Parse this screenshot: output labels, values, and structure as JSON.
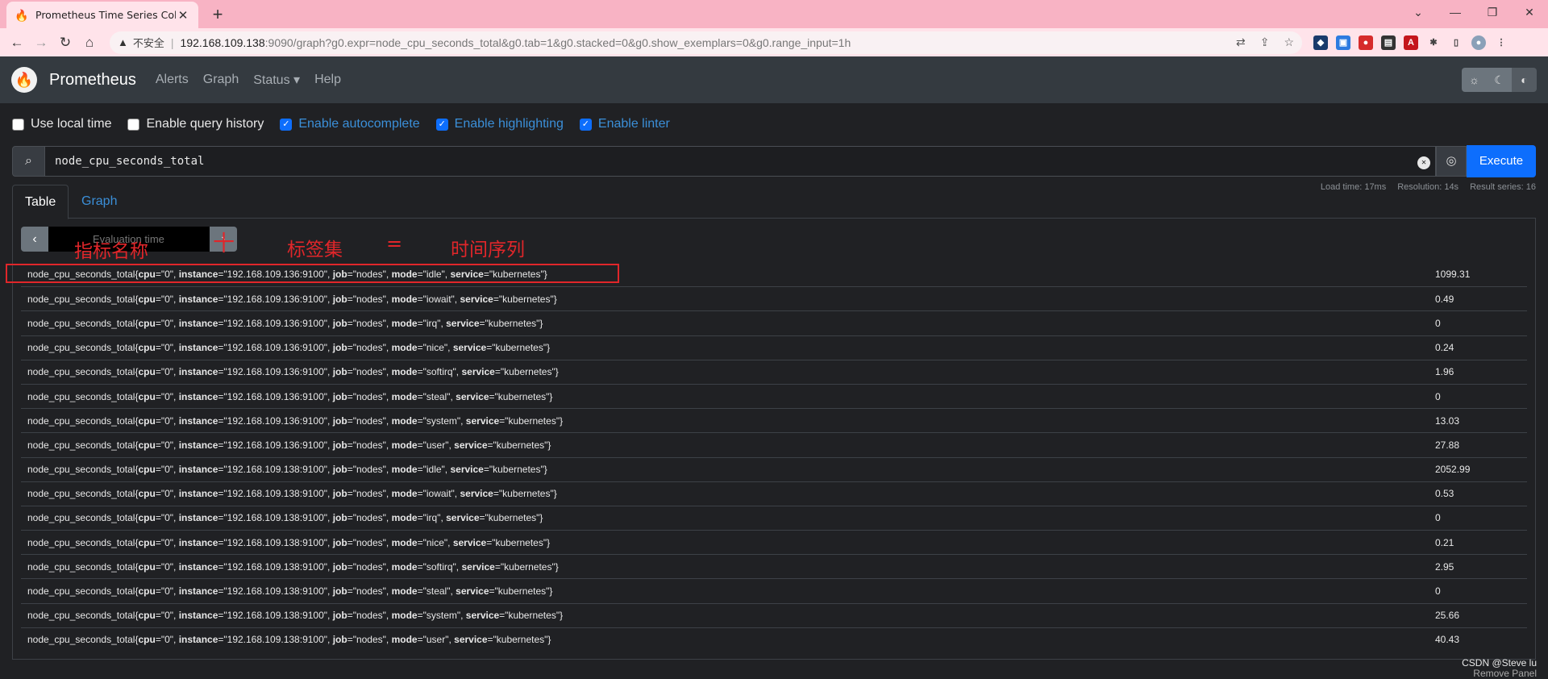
{
  "browser": {
    "tab_title": "Prometheus Time Series Collec",
    "new_tab": "+",
    "insecure_label": "不安全",
    "url_host": "192.168.109.138",
    "url_rest": ":9090/graph?g0.expr=node_cpu_seconds_total&g0.tab=1&g0.stacked=0&g0.show_exemplars=0&g0.range_input=1h"
  },
  "navbar": {
    "brand": "Prometheus",
    "links": [
      "Alerts",
      "Graph",
      "Status ▾",
      "Help"
    ]
  },
  "options": [
    {
      "label": "Use local time",
      "checked": false
    },
    {
      "label": "Enable query history",
      "checked": false
    },
    {
      "label": "Enable autocomplete",
      "checked": true
    },
    {
      "label": "Enable highlighting",
      "checked": true
    },
    {
      "label": "Enable linter",
      "checked": true
    }
  ],
  "query": {
    "expression": "node_cpu_seconds_total",
    "execute_label": "Execute"
  },
  "tabs": {
    "table": "Table",
    "graph": "Graph"
  },
  "stats": {
    "load_time": "Load time: 17ms",
    "resolution": "Resolution: 14s",
    "result_series": "Result series: 16"
  },
  "eval": {
    "placeholder": "Evaluation time"
  },
  "results": [
    {
      "cpu": "0",
      "instance": "192.168.109.136:9100",
      "job": "nodes",
      "mode": "idle",
      "service": "kubernetes",
      "value": "1099.31"
    },
    {
      "cpu": "0",
      "instance": "192.168.109.136:9100",
      "job": "nodes",
      "mode": "iowait",
      "service": "kubernetes",
      "value": "0.49"
    },
    {
      "cpu": "0",
      "instance": "192.168.109.136:9100",
      "job": "nodes",
      "mode": "irq",
      "service": "kubernetes",
      "value": "0"
    },
    {
      "cpu": "0",
      "instance": "192.168.109.136:9100",
      "job": "nodes",
      "mode": "nice",
      "service": "kubernetes",
      "value": "0.24"
    },
    {
      "cpu": "0",
      "instance": "192.168.109.136:9100",
      "job": "nodes",
      "mode": "softirq",
      "service": "kubernetes",
      "value": "1.96"
    },
    {
      "cpu": "0",
      "instance": "192.168.109.136:9100",
      "job": "nodes",
      "mode": "steal",
      "service": "kubernetes",
      "value": "0"
    },
    {
      "cpu": "0",
      "instance": "192.168.109.136:9100",
      "job": "nodes",
      "mode": "system",
      "service": "kubernetes",
      "value": "13.03"
    },
    {
      "cpu": "0",
      "instance": "192.168.109.136:9100",
      "job": "nodes",
      "mode": "user",
      "service": "kubernetes",
      "value": "27.88"
    },
    {
      "cpu": "0",
      "instance": "192.168.109.138:9100",
      "job": "nodes",
      "mode": "idle",
      "service": "kubernetes",
      "value": "2052.99"
    },
    {
      "cpu": "0",
      "instance": "192.168.109.138:9100",
      "job": "nodes",
      "mode": "iowait",
      "service": "kubernetes",
      "value": "0.53"
    },
    {
      "cpu": "0",
      "instance": "192.168.109.138:9100",
      "job": "nodes",
      "mode": "irq",
      "service": "kubernetes",
      "value": "0"
    },
    {
      "cpu": "0",
      "instance": "192.168.109.138:9100",
      "job": "nodes",
      "mode": "nice",
      "service": "kubernetes",
      "value": "0.21"
    },
    {
      "cpu": "0",
      "instance": "192.168.109.138:9100",
      "job": "nodes",
      "mode": "softirq",
      "service": "kubernetes",
      "value": "2.95"
    },
    {
      "cpu": "0",
      "instance": "192.168.109.138:9100",
      "job": "nodes",
      "mode": "steal",
      "service": "kubernetes",
      "value": "0"
    },
    {
      "cpu": "0",
      "instance": "192.168.109.138:9100",
      "job": "nodes",
      "mode": "system",
      "service": "kubernetes",
      "value": "25.66"
    },
    {
      "cpu": "0",
      "instance": "192.168.109.138:9100",
      "job": "nodes",
      "mode": "user",
      "service": "kubernetes",
      "value": "40.43"
    }
  ],
  "metric_name": "node_cpu_seconds_total",
  "annotations": {
    "metric_name_label": "指标名称",
    "plus": "十",
    "label_set": "标签集",
    "equals": "=",
    "time_series": "时间序列"
  },
  "watermark": {
    "line1": "CSDN @Steve lu",
    "line2": "Remove Panel"
  },
  "colors": {
    "accent": "#0d6efd",
    "annotation": "#e0262a"
  }
}
